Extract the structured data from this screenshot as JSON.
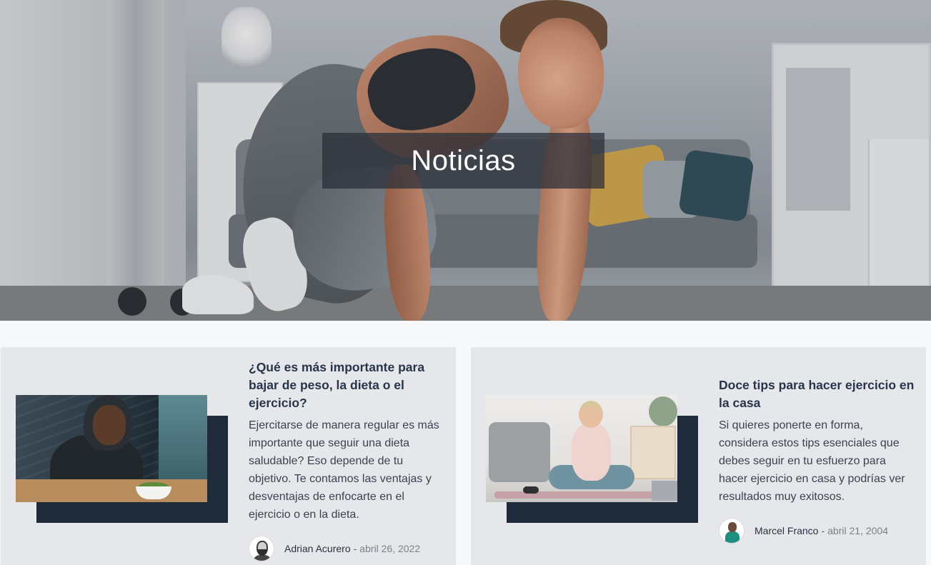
{
  "hero": {
    "title": "Noticias"
  },
  "articles": [
    {
      "title": "¿Qué es más importante para bajar de peso, la dieta o el ejercicio?",
      "excerpt": "Ejercitarse de manera regular es más importante que seguir una dieta saludable? Eso depende de tu objetivo. Te contamos las ventajas y desventajas de enfocarte en el ejercicio o en la dieta.",
      "author": "Adrian Acurero",
      "separator": "-",
      "date": "abril 26, 2022"
    },
    {
      "title": "Doce tips para hacer ejercicio en la casa",
      "excerpt": "Si quieres ponerte en forma, considera estos tips esenciales que debes seguir en tu esfuerzo para hacer ejercicio en casa y podrías ver resultados muy exitosos.",
      "author": "Marcel Franco",
      "separator": "-",
      "date": "abril 21, 2004"
    }
  ],
  "colors": {
    "card_background": "#e6e7ea",
    "thumb_shadow": "#1f2a3b",
    "title_text": "#28344a",
    "page_background": "#f7f8fa"
  }
}
